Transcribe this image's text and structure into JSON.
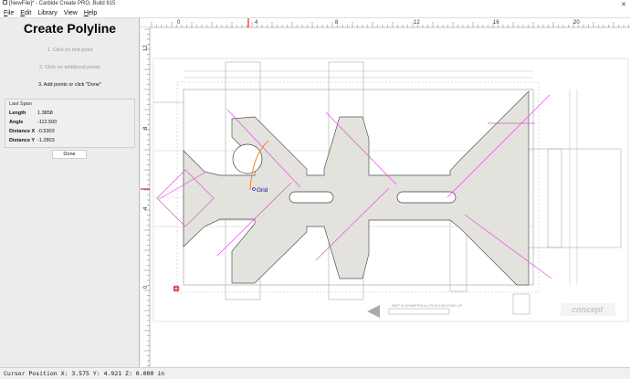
{
  "window": {
    "title": "[NewFile]* - Carbide Create PRO, Build 815"
  },
  "menu": [
    {
      "label": "File",
      "key": "F",
      "rest": "ile"
    },
    {
      "label": "Edit",
      "key": "E",
      "rest": "dit"
    },
    {
      "label": "Library",
      "key": "",
      "rest": "Library"
    },
    {
      "label": "View",
      "key": "",
      "rest": "View"
    },
    {
      "label": "Help",
      "key": "H",
      "rest": "elp"
    }
  ],
  "sidebar": {
    "title": "Create Polyline",
    "steps": [
      "1. Click on first point",
      "2. Click on additional points",
      "3. Add points or click \"Done\""
    ],
    "last_span": {
      "title": "Last Span",
      "rows": [
        {
          "label": "Length",
          "value": "1.3858"
        },
        {
          "label": "Angle",
          "value": "-112.500"
        },
        {
          "label": "Distance X",
          "value": "-0.5303"
        },
        {
          "label": "Distance Y",
          "value": "-1.2803"
        }
      ]
    },
    "done_label": "Done"
  },
  "ruler": {
    "top_ticks": [
      "0",
      "4",
      "8",
      "12",
      "16",
      "20"
    ],
    "left_ticks": [
      "12",
      "8",
      "4",
      "0"
    ]
  },
  "canvas": {
    "grid_label": "Grid",
    "note_text": "PART IS SYMMETRICAL FROM THIS POINT UP",
    "logo_text": "concept",
    "colors": {
      "accent": "#e04fe0",
      "orange": "#f08a1a",
      "part_fill": "#e4e2dc",
      "ruler_marker": "#cc0000",
      "grid_label": "#0000cc"
    }
  },
  "status": {
    "text": "Cursor Position X: 3.575 Y: 4.921 Z: 0.000 in"
  }
}
